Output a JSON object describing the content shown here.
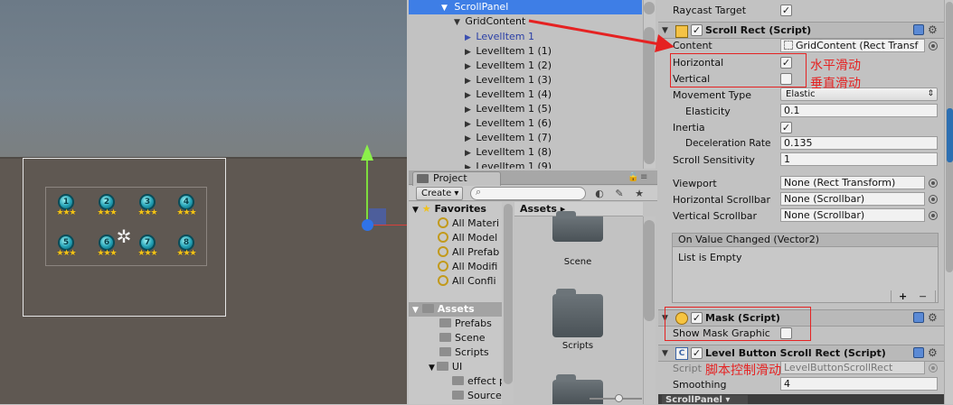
{
  "hierarchy": {
    "selected_item": "ScrollPanel",
    "child_item": "GridContent",
    "level_items": [
      "LevelItem 1",
      "LevelItem 1 (1)",
      "LevelItem 1 (2)",
      "LevelItem 1 (3)",
      "LevelItem 1 (4)",
      "LevelItem 1 (5)",
      "LevelItem 1 (6)",
      "LevelItem 1 (7)",
      "LevelItem 1 (8)",
      "LevelItem 1 (9)"
    ]
  },
  "scene": {
    "level_numbers_row1": [
      "1",
      "2",
      "3",
      "4"
    ],
    "level_numbers_row2": [
      "5",
      "6",
      "7",
      "8"
    ],
    "stars": "★★★"
  },
  "project": {
    "tab_label": "Project",
    "create_label": "Create ▾",
    "favorites_label": "Favorites",
    "favorites": [
      "All Materi",
      "All Model",
      "All Prefab",
      "All Modifi",
      "All Confli"
    ],
    "assets_label": "Assets",
    "asset_folders": [
      "Prefabs",
      "Scene",
      "Scripts",
      "UI",
      "effect p",
      "Source"
    ],
    "breadcrumb": "Assets",
    "breadcrumb_arrow": "▸",
    "grid_folders": [
      "Scene",
      "Scripts"
    ]
  },
  "inspector": {
    "raycast_label": "Raycast Target",
    "raycast_checked": true,
    "scroll_rect": {
      "title": "Scroll Rect (Script)",
      "content_label": "Content",
      "content_value": "GridContent (Rect Transf",
      "horizontal_label": "Horizontal",
      "horizontal_checked": true,
      "vertical_label": "Vertical",
      "vertical_checked": false,
      "movement_label": "Movement Type",
      "movement_value": "Elastic",
      "elasticity_label": "Elasticity",
      "elasticity_value": "0.1",
      "inertia_label": "Inertia",
      "inertia_checked": true,
      "decel_label": "Deceleration Rate",
      "decel_value": "0.135",
      "sensitivity_label": "Scroll Sensitivity",
      "sensitivity_value": "1",
      "viewport_label": "Viewport",
      "viewport_value": "None (Rect Transform)",
      "hscroll_label": "Horizontal Scrollbar",
      "hscroll_value": "None (Scrollbar)",
      "vscroll_label": "Vertical Scrollbar",
      "vscroll_value": "None (Scrollbar)",
      "event_label": "On Value Changed (Vector2)",
      "event_empty": "List is Empty",
      "add_label": "+",
      "remove_label": "−"
    },
    "mask": {
      "title": "Mask (Script)",
      "show_graphic_label": "Show Mask Graphic",
      "show_graphic_checked": false
    },
    "level_scroll": {
      "title": "Level Button Scroll Rect (Script)",
      "script_label": "Script",
      "script_value": "LevelButtonScrollRect",
      "smoothing_label": "Smoothing",
      "smoothing_value": "4"
    },
    "bottom_tab": "ScrollPanel"
  },
  "annotations": {
    "horizontal_note": "水平滑动",
    "vertical_note": "垂直滑动",
    "script_note": "脚本控制滑动",
    "color": "#e52222"
  },
  "colors": {
    "selection": "#3e7ee6",
    "panel": "#c2c2c2",
    "scene_ground": "#5f5852"
  }
}
